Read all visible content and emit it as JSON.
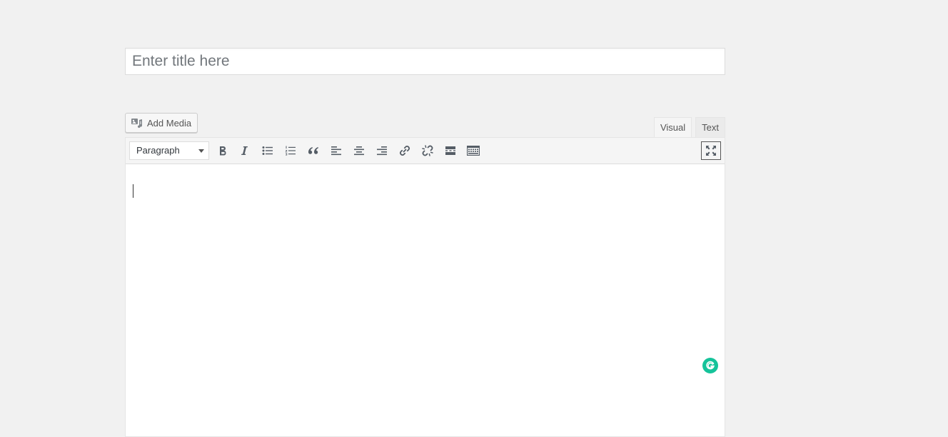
{
  "title_field": {
    "placeholder": "Enter title here",
    "value": ""
  },
  "media": {
    "add_media_label": "Add Media",
    "icon": "add-media-icon"
  },
  "tabs": [
    {
      "label": "Visual",
      "active": true
    },
    {
      "label": "Text",
      "active": false
    }
  ],
  "toolbar": {
    "format_select": {
      "selected": "Paragraph"
    },
    "buttons": [
      {
        "name": "bold",
        "icon": "bold-icon"
      },
      {
        "name": "italic",
        "icon": "italic-icon"
      },
      {
        "name": "bulleted-list",
        "icon": "bulleted-list-icon"
      },
      {
        "name": "numbered-list",
        "icon": "numbered-list-icon"
      },
      {
        "name": "blockquote",
        "icon": "blockquote-icon"
      },
      {
        "name": "align-left",
        "icon": "align-left-icon"
      },
      {
        "name": "align-center",
        "icon": "align-center-icon"
      },
      {
        "name": "align-right",
        "icon": "align-right-icon"
      },
      {
        "name": "insert-link",
        "icon": "link-icon"
      },
      {
        "name": "remove-link",
        "icon": "unlink-icon"
      },
      {
        "name": "read-more",
        "icon": "read-more-icon"
      },
      {
        "name": "toolbar-toggle",
        "icon": "keyboard-icon"
      },
      {
        "name": "distraction-free",
        "icon": "fullscreen-icon"
      }
    ]
  },
  "content": {
    "text": ""
  },
  "colors": {
    "background": "#f1f1f1",
    "grammarly": "#15c39a"
  }
}
